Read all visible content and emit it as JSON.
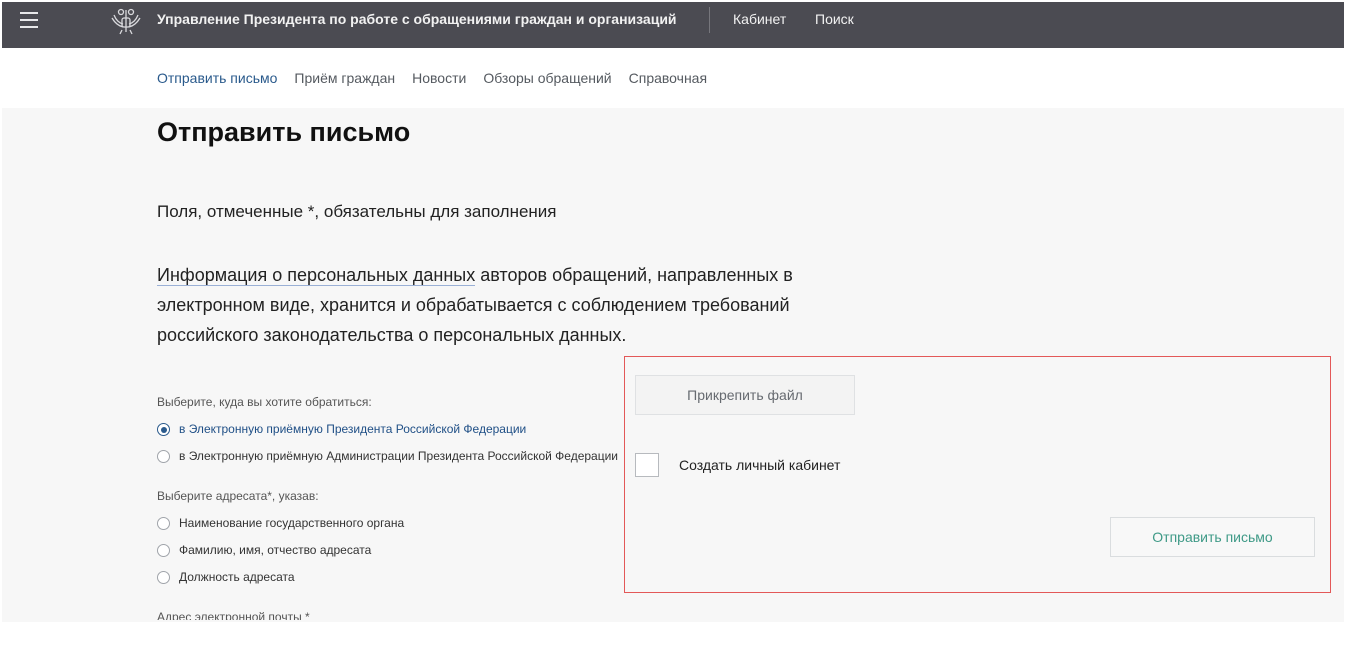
{
  "header": {
    "menu_icon": "hamburger-icon",
    "emblem_icon": "coat-of-arms-icon",
    "title": "Управление Президента по работе с обращениями граждан и организаций",
    "links": [
      "Кабинет",
      "Поиск"
    ]
  },
  "subnav": {
    "items": [
      "Отправить письмо",
      "Приём граждан",
      "Новости",
      "Обзоры обращений",
      "Справочная"
    ],
    "active_color": "#2a5a8c"
  },
  "main": {
    "title": "Отправить письмо",
    "required_note": "Поля, отмеченные *, обязательны для заполнения",
    "info_link": "Информация о персональных данных",
    "info_rest": " авторов обращений, направленных в электронном виде, хранится и обрабатывается с соблюдением требований российского законодательства о персональных данных."
  },
  "form": {
    "destination_label": "Выберите, куда вы хотите обратиться:",
    "destination_options": [
      {
        "label": "в Электронную приёмную Президента Российской Федерации",
        "checked": true
      },
      {
        "label": "в Электронную приёмную Администрации Президента Российской Федерации",
        "checked": false
      }
    ],
    "addressee_label": "Выберите адресата*, указав:",
    "addressee_options": [
      {
        "label": "Наименование государственного органа",
        "checked": false
      },
      {
        "label": "Фамилию, имя, отчество адресата",
        "checked": false
      },
      {
        "label": "Должность адресата",
        "checked": false
      }
    ],
    "email_label": "Адрес электронной почты *"
  },
  "actions": {
    "attach_label": "Прикрепить файл",
    "create_cabinet_label": "Создать личный кабинет",
    "create_cabinet_checked": false,
    "submit_label": "Отправить письмо",
    "frame_color": "#e35858",
    "submit_color": "#3f9a87"
  }
}
